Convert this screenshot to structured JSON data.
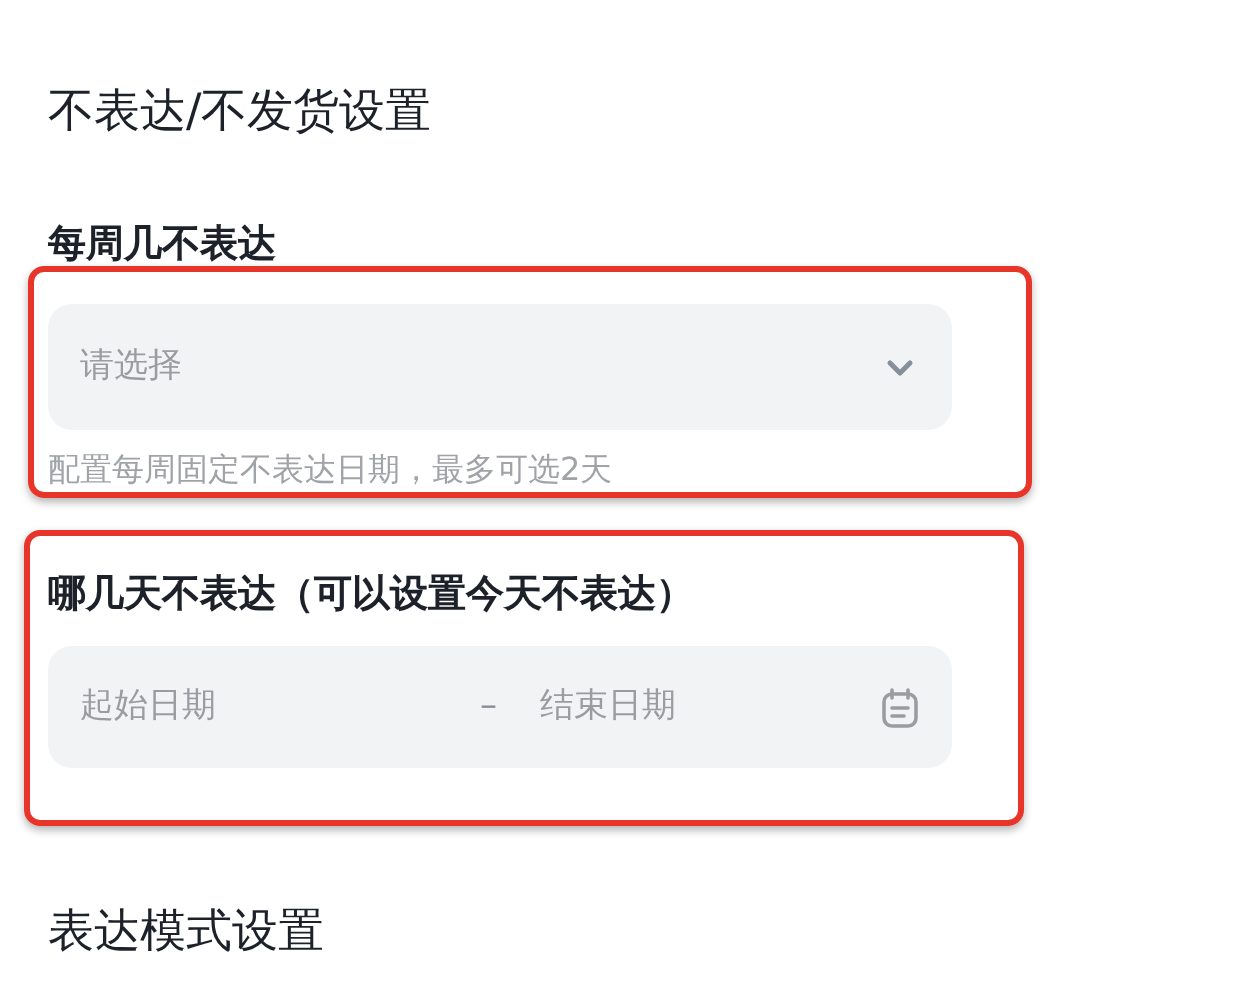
{
  "section_title": "不表达/不发货设置",
  "weekly": {
    "label": "每周几不表达",
    "select": {
      "placeholder": "请选择"
    },
    "help": "配置每周固定不表达日期，最多可选2天"
  },
  "dates": {
    "label": "哪几天不表达（可以设置今天不表达）",
    "start": {
      "placeholder": "起始日期"
    },
    "separator": "–",
    "end": {
      "placeholder": "结束日期"
    }
  },
  "next_section_title": "表达模式设置"
}
